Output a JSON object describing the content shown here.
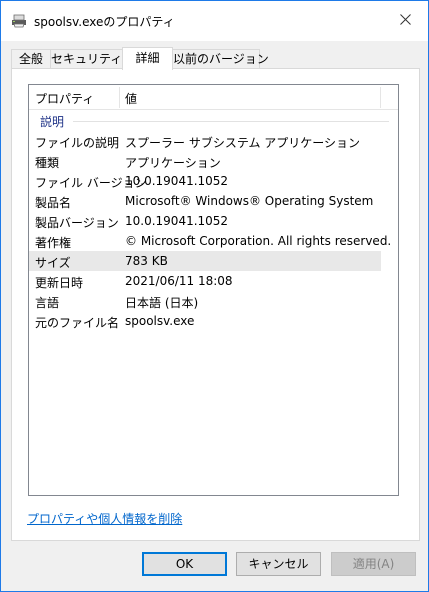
{
  "window": {
    "title": "spoolsv.exeのプロパティ",
    "title_icon": "printer-icon",
    "close_icon": "close-icon"
  },
  "tabs": [
    {
      "label": "全般",
      "active": false
    },
    {
      "label": "セキュリティ",
      "active": false
    },
    {
      "label": "詳細",
      "active": true
    },
    {
      "label": "以前のバージョン",
      "active": false
    }
  ],
  "details": {
    "header": {
      "property": "プロパティ",
      "value": "値"
    },
    "group": "説明",
    "rows": [
      {
        "key": "ファイルの説明",
        "value": "スプーラー サブシステム アプリケーション"
      },
      {
        "key": "種類",
        "value": "アプリケーション"
      },
      {
        "key": "ファイル バージョン",
        "value": "10.0.19041.1052"
      },
      {
        "key": "製品名",
        "value": "Microsoft® Windows® Operating System"
      },
      {
        "key": "製品バージョン",
        "value": "10.0.19041.1052"
      },
      {
        "key": "著作権",
        "value": "© Microsoft Corporation. All rights reserved."
      },
      {
        "key": "サイズ",
        "value": "783 KB"
      },
      {
        "key": "更新日時",
        "value": "2021/06/11 18:08"
      },
      {
        "key": "言語",
        "value": "日本語 (日本)"
      },
      {
        "key": "元のファイル名",
        "value": "spoolsv.exe"
      }
    ],
    "selected_row": "サイズ"
  },
  "remove_link": "プロパティや個人情報を削除",
  "buttons": {
    "ok": "OK",
    "cancel": "キャンセル",
    "apply": "適用(A)"
  },
  "colors": {
    "border_accent": "#1e7ae8",
    "link": "#0066cc",
    "group_label": "#1e3287"
  }
}
